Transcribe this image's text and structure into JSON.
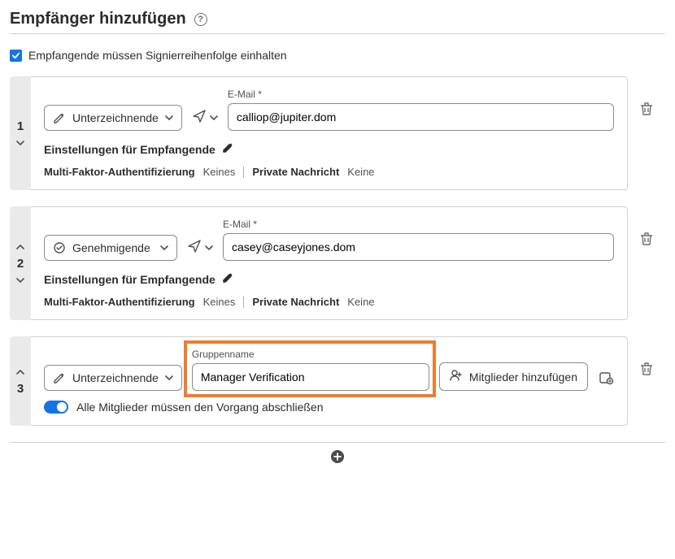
{
  "title": "Empfänger hinzufügen",
  "checkbox_label": "Empfangende müssen Signierreihenfolge einhalten",
  "labels": {
    "email": "E-Mail *",
    "group_name": "Gruppenname",
    "settings": "Einstellungen für Empfangende",
    "mfa": "Multi-Faktor-Authentifizierung",
    "private_msg": "Private Nachricht",
    "add_members": "Mitglieder hinzufügen",
    "all_members_toggle": "Alle Mitglieder müssen den Vorgang abschließen"
  },
  "values": {
    "none_mfa": "Keines",
    "none_msg": "Keine"
  },
  "recipients": [
    {
      "order": "1",
      "role": "Unterzeichnende",
      "email": "calliop@jupiter.dom",
      "show_up": false,
      "show_down": true
    },
    {
      "order": "2",
      "role": "Genehmigende",
      "email": "casey@caseyjones.dom",
      "show_up": true,
      "show_down": true
    }
  ],
  "group": {
    "order": "3",
    "role": "Unterzeichnende",
    "name": "Manager Verification"
  }
}
